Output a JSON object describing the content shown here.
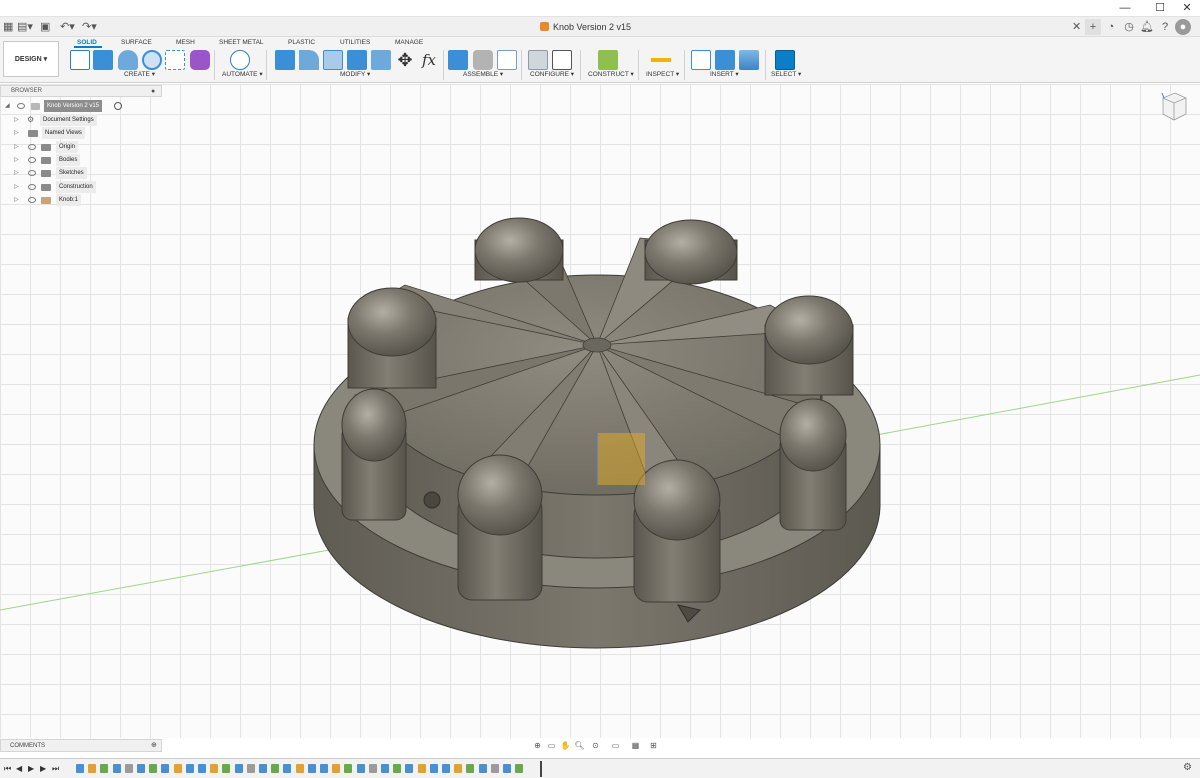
{
  "window": {
    "title": "Knob Version 2 v15",
    "minimize": "—",
    "maximize": "☐",
    "close": "✕"
  },
  "ribbon": {
    "workspace": "DESIGN ▾",
    "tabs": [
      {
        "label": "SOLID",
        "active": true
      },
      {
        "label": "SURFACE"
      },
      {
        "label": "MESH"
      },
      {
        "label": "SHEET METAL"
      },
      {
        "label": "PLASTIC"
      },
      {
        "label": "UTILITIES"
      },
      {
        "label": "MANAGE"
      }
    ],
    "groups": {
      "create": "CREATE ▾",
      "automate": "AUTOMATE ▾",
      "modify": "MODIFY ▾",
      "assemble": "ASSEMBLE ▾",
      "configure": "CONFIGURE ▾",
      "construct": "CONSTRUCT ▾",
      "inspect": "INSPECT ▾",
      "insert": "INSERT ▾",
      "select": "SELECT ▾"
    },
    "accent_color": "#0a7ec9"
  },
  "browser": {
    "header": "BROWSER",
    "root": "Knob Version 2 v15",
    "items": [
      {
        "label": "Document Settings",
        "icon": "gear-icon"
      },
      {
        "label": "Named Views",
        "icon": "folder-icon"
      },
      {
        "label": "Origin",
        "icon": "folder-icon"
      },
      {
        "label": "Bodies",
        "icon": "folder-icon"
      },
      {
        "label": "Sketches",
        "icon": "folder-icon"
      },
      {
        "label": "Construction",
        "icon": "folder-icon"
      },
      {
        "label": "Knob:1",
        "icon": "component-icon"
      }
    ]
  },
  "comments": {
    "label": "COMMENTS"
  },
  "model": {
    "name": "Knob",
    "body_color": "#7a766b",
    "lobe_count": 8
  }
}
